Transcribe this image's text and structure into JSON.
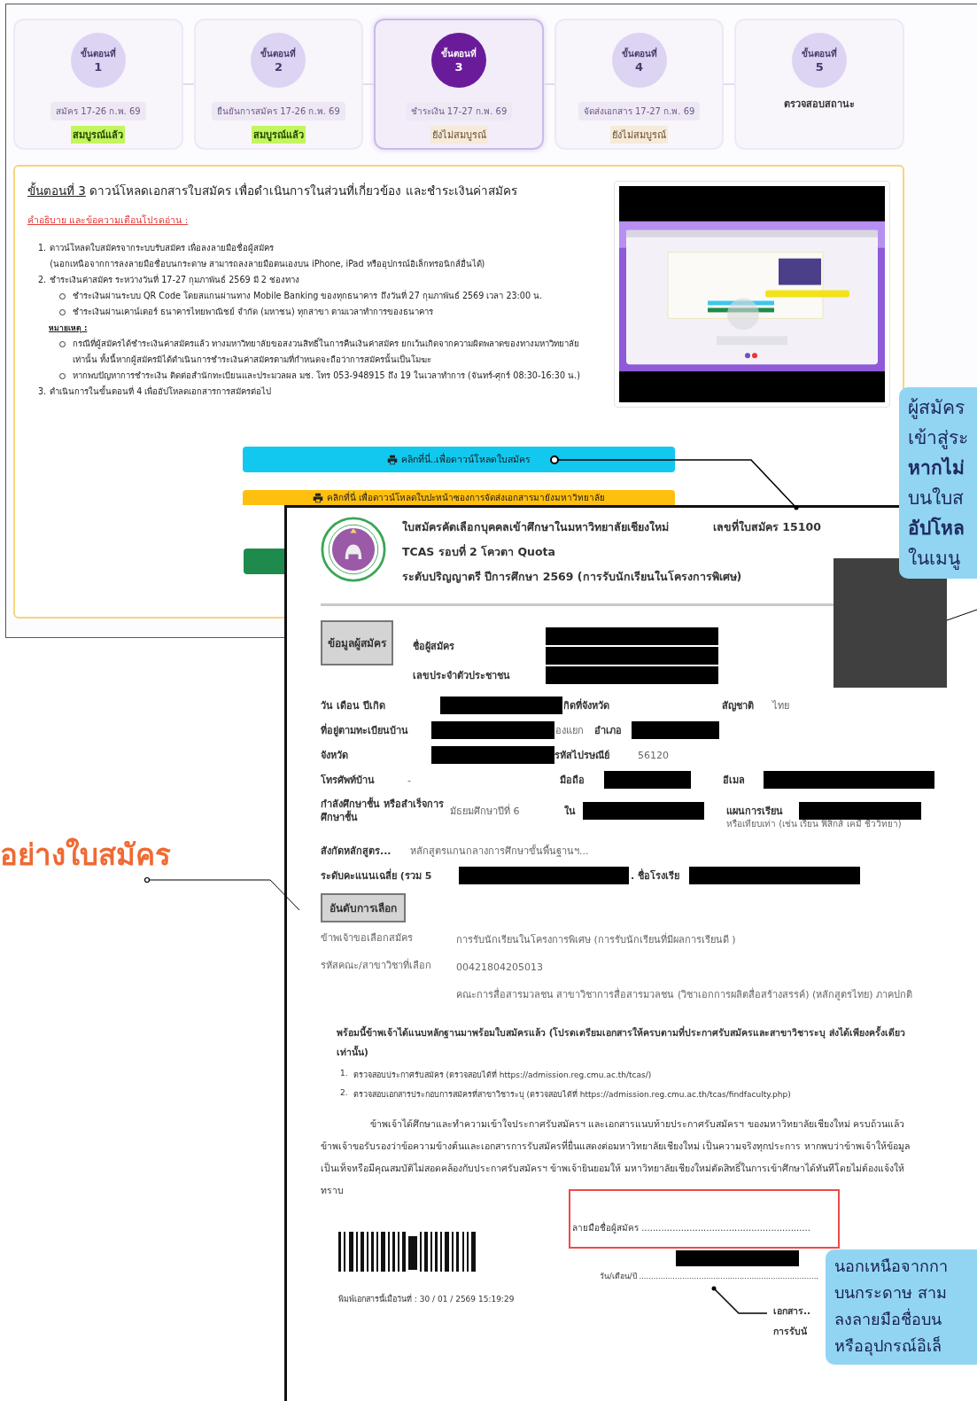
{
  "steps": [
    {
      "label": "ขั้นตอนที่",
      "number": "1",
      "date": "สมัคร 17-26 ก.พ. 69",
      "status": "สมบูรณ์แล้ว",
      "complete": true,
      "selected": false
    },
    {
      "label": "ขั้นตอนที่",
      "number": "2",
      "date": "ยืนยันการสมัคร 17-26 ก.พ. 69",
      "status": "สมบูรณ์แล้ว",
      "complete": true,
      "selected": false
    },
    {
      "label": "ขั้นตอนที่",
      "number": "3",
      "date": "ชำระเงิน 17-27 ก.พ. 69",
      "status": "ยังไม่สมบูรณ์",
      "complete": false,
      "selected": true
    },
    {
      "label": "ขั้นตอนที่",
      "number": "4",
      "date": "จัดส่งเอกสาร 17-27 ก.พ. 69",
      "status": "ยังไม่สมบูรณ์",
      "complete": false,
      "selected": false
    },
    {
      "label": "ขั้นตอนที่",
      "number": "5",
      "status": "ตรวจสอบสถานะ",
      "selected": false
    }
  ],
  "panel": {
    "title_link": "ขั้นตอนที่ 3",
    "title": "ดาวน์โหลดเอกสารใบสมัคร เพื่อดำเนินการในส่วนที่เกี่ยวข้อง และชำระเงินค่าสมัคร",
    "warning": "คำอธิบาย และข้อความเตือนโปรดอ่าน :",
    "instructions": [
      {
        "marker": "1.",
        "text": "ดาวน์โหลดใบสมัครจากระบบรับสมัคร เพื่อลงลายมือชื่อผู้สมัคร",
        "subtext": "(นอกเหนือจากการลงลายมือชื่อบนกระดาษ สามารถลงลายมือตนเองบน iPhone, iPad หรืออุปกรณ์อิเล็กทรอนิกส์อื่นได้)"
      },
      {
        "marker": "2.",
        "text": "ชำระเงินค่าสมัคร ระหว่างวันที่ 17-27 กุมภาพันธ์ 2569 มี 2 ช่องทาง",
        "children": [
          {
            "text": "ชำระเงินผ่านระบบ QR Code โดยสแกนผ่านทาง Mobile Banking ของทุกธนาคาร ถึงวันที่ 27 กุมภาพันธ์ 2569 เวลา 23:00 น."
          },
          {
            "text": "ชำระเงินผ่านเคาน์เตอร์ ธนาคารไทยพาณิชย์ จำกัด (มหาชน) ทุกสาขา ตามเวลาทำการของธนาคาร"
          }
        ],
        "note": {
          "heading": "หมายเหตุ :",
          "children": [
            {
              "text": "กรณีที่ผู้สมัครได้ชำระเงินค่าสมัครแล้ว ทางมหาวิทยาลัยขอสงวนสิทธิ์ในการคืนเงินค่าสมัคร ยกเว้นเกิดจากความผิดพลาดของทางมหาวิทยาลัยเท่านั้น ทั้งนี้หากผู้สมัครมิได้ดำเนินการชำระเงินค่าสมัครตามที่กำหนดจะถือว่าการสมัครนั้นเป็นโมฆะ"
            },
            {
              "text": "หากพบปัญหาการชำระเงิน ติดต่อสำนักทะเบียนและประมวลผล มช. โทร 053-948915 ถึง 19 ในเวลาทำการ (จันทร์-ศุกร์ 08:30-16:30 น.)"
            }
          ]
        }
      },
      {
        "marker": "3.",
        "text": "ดำเนินการในขั้นตอนที่ 4 เพื่ออัปโหลดเอกสารการสมัครต่อไป"
      }
    ],
    "buttons": [
      {
        "color": "#12c8ef",
        "label": "คลิกที่นี่..เพื่อดาวน์โหลดใบสมัคร"
      },
      {
        "color": "#ffbf0f",
        "label": "คลิกที่นี่ เพื่อดาวน์โหลดใบปะหน้าซองการจัดส่งเอกสารมายังมหาวิทยาลัย"
      },
      {
        "color": "#1e8b4d"
      }
    ]
  },
  "document": {
    "title": "ใบสมัครคัดเลือกบุคคลเข้าศึกษาในมหาวิทยาลัยเชียงใหม่",
    "application_no": "เลขที่ใบสมัคร 15100",
    "subtitle": "TCAS รอบที่ 2 โควตา Quota",
    "level": "ระดับปริญญาตรี ปีการศึกษา 2569 (การรับนักเรียนในโครงการพิเศษ)",
    "applicant_section": "ข้อมูลผู้สมัคร",
    "name_label": "ชื่อผู้สมัคร",
    "id_label": "เลขประจำตัวประชาชน",
    "rows": [
      [
        {
          "kind": "label",
          "text": "วัน เดือน ปีเกิด"
        },
        {
          "kind": "redacted"
        },
        {
          "kind": "label",
          "text": "กิดที่จังหวัด"
        },
        "",
        {
          "kind": "label",
          "text": "สัญชาติ"
        },
        {
          "kind": "value",
          "text": "ไทย"
        }
      ],
      [
        {
          "kind": "label",
          "text": "ที่อยู่ตามทะเบียนบ้าน"
        },
        {
          "kind": "redacted"
        },
        {
          "kind": "value",
          "text": "องแยก"
        },
        {
          "kind": "label",
          "text": "อำเภอ"
        },
        {
          "kind": "redacted"
        }
      ],
      [
        {
          "kind": "label",
          "text": "จังหวัด"
        },
        {
          "kind": "redacted"
        },
        {
          "kind": "label",
          "text": "รหัสไปรษณีย์"
        },
        {
          "kind": "value",
          "text": "56120"
        }
      ],
      [
        {
          "kind": "label",
          "text": "โทรศัพท์บ้าน"
        },
        {
          "kind": "value",
          "text": "-"
        },
        {
          "kind": "label",
          "text": "มือถือ"
        },
        {
          "kind": "redacted"
        },
        {
          "kind": "label",
          "text": "อีเมล"
        },
        {
          "kind": "redacted"
        }
      ],
      [
        {
          "kind": "label",
          "text": "กำลังศึกษาชั้น หรือสำเร็จการศึกษาชั้น"
        },
        {
          "kind": "value",
          "text": "มัธยมศึกษาปีที่ 6"
        },
        {
          "kind": "label",
          "text": "ใน"
        },
        {
          "kind": "redacted"
        },
        {
          "kind": "label",
          "text": "แผนการเรียน"
        },
        {
          "kind": "redacted"
        }
      ],
      [
        {
          "kind": "label",
          "text": "สังกัดหลักสูตร..."
        },
        {
          "kind": "value",
          "text": "หลักสูตรแกนกลางการศึกษาขั้นพื้นฐานฯ..."
        }
      ],
      [
        {
          "kind": "label",
          "text": "ระดับคะแนนเฉลี่ย (รวม 5"
        },
        {
          "kind": "redacted"
        },
        {
          "kind": "label",
          "text": ". ชื่อโรงเรีย"
        },
        {
          "kind": "redacted"
        }
      ]
    ],
    "plan_note": "หรือเทียบเท่า (เช่น เรียน ฟิสิกส์ เคมี ชีววิทยา)",
    "choice_section": "อันดับการเลือก",
    "choices": [
      {
        "label": "ข้าพเจ้าขอเลือกสมัคร",
        "value": "การรับนักเรียนในโครงการพิเศษ (การรับนักเรียนที่มีผลการเรียนดี )"
      },
      {
        "label": "รหัสคณะ/สาขาวิชาที่เลือก",
        "value": "00421804205013"
      },
      {
        "value": "คณะการสื่อสารมวลชน สาขาวิชาการสื่อสารมวลชน (วิชาเอกการผลิตสื่อสร้างสรรค์) (หลักสูตรไทย) ภาคปกติ"
      }
    ],
    "attach_note": "พร้อมนี้ข้าพเจ้าได้แนบหลักฐานมาพร้อมใบสมัครแล้ว (โปรดเตรียมเอกสารให้ครบตามที่ประกาศรับสมัครและสาขาวิชาระบุ ส่งได้เพียงครั้งเดียวเท่านั้น)",
    "checks": [
      {
        "marker": "1.",
        "text": "ตรวจสอบประกาศรับสมัคร (ตรวจสอบได้ที่ https://admission.reg.cmu.ac.th/tcas/)"
      },
      {
        "marker": "2.",
        "text": "ตรวจสอบเอกสารประกอบการสมัครที่สาขาวิชาระบุ (ตรวจสอบได้ที่ https://admission.reg.cmu.ac.th/tcas/findfaculty.php)"
      }
    ],
    "declaration": "ข้าพเจ้าได้ศึกษาและทำความเข้าใจประกาศรับสมัครฯ และเอกสารแนบท้ายประกาศรับสมัครฯ ของมหาวิทยาลัยเชียงใหม่ ครบถ้วนแล้ว ข้าพเจ้าขอรับรองว่าข้อความข้างต้นและเอกสารการรับสมัครที่ยื่นแสดงต่อมหาวิทยาลัยเชียงใหม่ เป็นความจริงทุกประการ หากพบว่าข้าพเจ้าให้ข้อมูลเป็นเท็จหรือมีคุณสมบัติไม่สอดคล้องกับประกาศรับสมัครฯ ข้าพเจ้ายินยอมให้ มหาวิทยาลัยเชียงใหม่ตัดสิทธิ์ในการเข้าศึกษาได้ทันทีโดยไม่ต้องแจ้งให้ทราบ",
    "signature_label": "ลายมือชื่อผู้สมัคร ............................................................",
    "date_label": "วัน/เดือน/ปี ...........................................................................",
    "printed_at": "พิมพ์เอกสารนี้เมื่อวันที่ : 30 / 01 / 2569 15:19:29",
    "footer_lines": [
      "เอกสาร..",
      "การรับนั"
    ]
  },
  "callouts": [
    {
      "lines": [
        {
          "text": "ผู้สมัคร",
          "bold": false
        },
        {
          "text": "เข้าสู่ระ",
          "bold": false
        },
        {
          "text": "หากไม่",
          "bold": true
        },
        {
          "text": "บนใบส",
          "bold": false
        },
        {
          "text": "อัปโหล",
          "bold": true
        },
        {
          "text": "ในเมนู",
          "bold": false
        }
      ]
    },
    {
      "lines": [
        {
          "text": "นอกเหนือจากกา",
          "bold": false
        },
        {
          "text": "บนกระดาษ สาม",
          "bold": false
        },
        {
          "text": "ลงลายมือชื่อบน",
          "bold": false
        },
        {
          "text": "หรืออุปกรณ์อิเล็",
          "bold": false
        }
      ]
    }
  ],
  "side_label": "อย่างใบสมัคร"
}
